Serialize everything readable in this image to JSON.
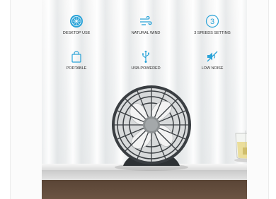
{
  "features": [
    {
      "label": "DESKTOP USE",
      "icon": "desktop-fan-icon"
    },
    {
      "label": "NATURAL WIND",
      "icon": "wind-icon"
    },
    {
      "label": "3 SPEEDS SETTING",
      "icon": "three-speeds-icon"
    },
    {
      "label": "PORTABLE",
      "icon": "bag-icon"
    },
    {
      "label": "USB-POWERED",
      "icon": "usb-icon"
    },
    {
      "label": "LOW NOISE",
      "icon": "mute-icon"
    }
  ],
  "colors": {
    "icon_accent": "#2aa3d8",
    "label": "#333333"
  }
}
